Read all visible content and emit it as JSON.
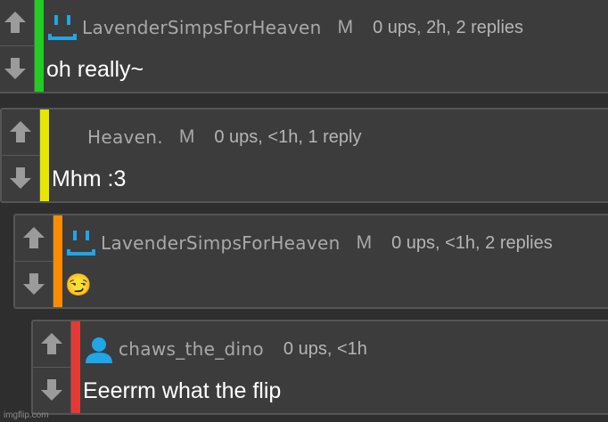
{
  "comments": [
    {
      "username": "LavenderSimpsForHeaven",
      "gender": "M",
      "meta": "0 ups, 2h, 2 replies",
      "text": "oh really~",
      "bar_color": "#22cc22",
      "avatar": "smiley-avatar-icon"
    },
    {
      "username": "Heaven.",
      "gender": "M",
      "meta": "0 ups, <1h, 1 reply",
      "text": "Mhm :3",
      "bar_color": "#e6e600",
      "avatar": "none"
    },
    {
      "username": "LavenderSimpsForHeaven",
      "gender": "M",
      "meta": "0 ups, <1h, 2 replies",
      "text": "😏",
      "bar_color": "#ff8c00",
      "avatar": "smiley-avatar-icon"
    },
    {
      "username": "chaws_the_dino",
      "gender": "",
      "meta": "0 ups, <1h",
      "text": "Eeerrm what the flip",
      "bar_color": "#e53935",
      "avatar": "person-avatar-icon"
    }
  ],
  "watermark": "imgflip.com",
  "colors": {
    "background": "#2e2e2e",
    "card": "#3c3c3c",
    "border": "#555555",
    "avatar_blue": "#1fa6e8"
  }
}
